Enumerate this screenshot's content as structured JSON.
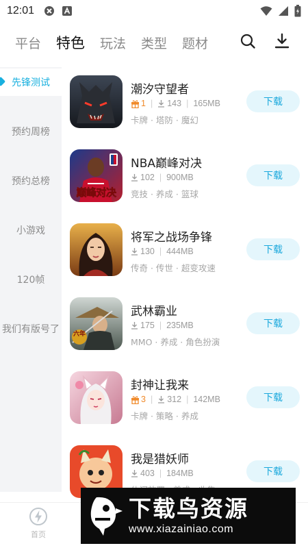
{
  "status_bar": {
    "time": "12:01"
  },
  "top_tabs": [
    {
      "label": "平台",
      "active": false
    },
    {
      "label": "特色",
      "active": true
    },
    {
      "label": "玩法",
      "active": false
    },
    {
      "label": "类型",
      "active": false
    },
    {
      "label": "题材",
      "active": false
    }
  ],
  "sidebar": {
    "items": [
      {
        "label": "先锋测试",
        "active": true
      },
      {
        "label": "预约周榜",
        "active": false
      },
      {
        "label": "预约总榜",
        "active": false
      },
      {
        "label": "小游戏",
        "active": false
      },
      {
        "label": "120帧",
        "active": false
      },
      {
        "label": "我们有版号了",
        "active": false
      }
    ]
  },
  "games": [
    {
      "name": "潮汐守望者",
      "gift": "1",
      "downloads": "143",
      "size": "165MB",
      "tags": "卡牌 · 塔防 · 魔幻",
      "button": "下载",
      "icon": "werewolf-icon"
    },
    {
      "name": "NBA巅峰对决",
      "gift": "",
      "downloads": "102",
      "size": "900MB",
      "tags": "竞技 · 养成 · 篮球",
      "button": "下载",
      "icon": "basketball-player-icon",
      "icon_text": "巅峰对决"
    },
    {
      "name": "将军之战场争锋",
      "gift": "",
      "downloads": "130",
      "size": "444MB",
      "tags": "传奇 · 传世 · 超变攻速",
      "button": "下载",
      "icon": "warrior-woman-icon"
    },
    {
      "name": "武林霸业",
      "gift": "",
      "downloads": "175",
      "size": "235MB",
      "tags": "MMO · 养成 · 角色扮演",
      "button": "下载",
      "icon": "swordsman-icon",
      "icon_text": "六年"
    },
    {
      "name": "封神让我来",
      "gift": "3",
      "downloads": "312",
      "size": "142MB",
      "tags": "卡牌 · 策略 · 养成",
      "button": "下载",
      "icon": "fox-girl-icon"
    },
    {
      "name": "我是猎妖师",
      "gift": "",
      "downloads": "403",
      "size": "184MB",
      "tags": "休闲放置 · 养成 · 收集",
      "button": "下载",
      "icon": "cartoon-demon-icon"
    }
  ],
  "bottom_nav": {
    "home_label": "首页"
  },
  "watermark": {
    "title": "下载鸟资源",
    "url": "www.xiazainiao.com"
  },
  "colors": {
    "accent": "#19b0df",
    "button_bg": "#e4f6fc",
    "gift": "#f08a2a",
    "sidebar_bg": "#f3f4f6"
  }
}
